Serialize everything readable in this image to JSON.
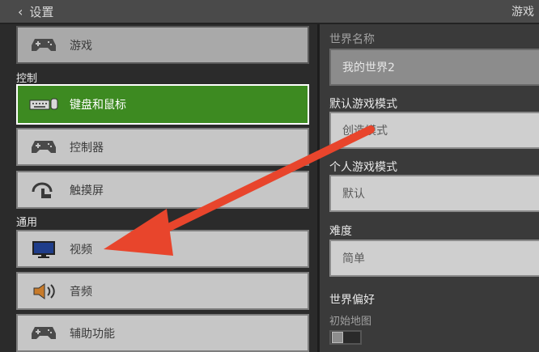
{
  "header": {
    "back_label": "设置",
    "right_label": "游戏"
  },
  "left_panel": {
    "top_item": {
      "label": "游戏",
      "icon": "gamepad-icon"
    },
    "sections": [
      {
        "title": "控制",
        "items": [
          {
            "label": "键盘和鼠标",
            "icon": "keyboard-mouse-icon",
            "active": true
          },
          {
            "label": "控制器",
            "icon": "gamepad-icon"
          },
          {
            "label": "触摸屏",
            "icon": "touch-icon"
          }
        ]
      },
      {
        "title": "通用",
        "items": [
          {
            "label": "视频",
            "icon": "monitor-icon"
          },
          {
            "label": "音频",
            "icon": "speaker-icon"
          },
          {
            "label": "辅助功能",
            "icon": "gamepad-icon"
          }
        ]
      }
    ]
  },
  "right_panel": {
    "world_name": {
      "label": "世界名称",
      "value": "我的世界2"
    },
    "default_game_mode": {
      "label": "默认游戏模式",
      "value": "创造模式"
    },
    "personal_game_mode": {
      "label": "个人游戏模式",
      "value": "默认"
    },
    "difficulty": {
      "label": "难度",
      "value": "简单"
    },
    "world_preferences": {
      "label": "世界偏好",
      "starting_map_label": "初始地图",
      "starting_map_on": false
    }
  },
  "colors": {
    "accent_green": "#3d8a21",
    "arrow_red": "#e8452c"
  }
}
